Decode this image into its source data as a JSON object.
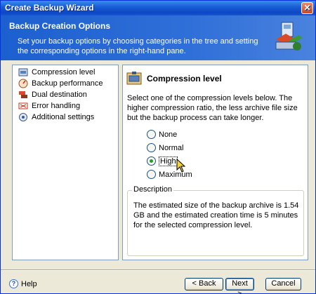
{
  "window": {
    "title": "Create Backup Wizard",
    "close_glyph": "✕"
  },
  "header": {
    "title": "Backup Creation Options",
    "description": "Set your backup options by choosing categories in the tree and setting the corresponding options in the right-hand pane.",
    "icon": "backup-wizard-icon"
  },
  "tree": {
    "items": [
      {
        "label": "Compression level",
        "icon": "compression-icon"
      },
      {
        "label": "Backup performance",
        "icon": "performance-icon"
      },
      {
        "label": "Dual destination",
        "icon": "dual-destination-icon"
      },
      {
        "label": "Error handling",
        "icon": "error-handling-icon"
      },
      {
        "label": "Additional settings",
        "icon": "additional-settings-icon"
      }
    ]
  },
  "pane": {
    "title": "Compression level",
    "description": "Select one of the compression levels below. The higher compression ratio, the less archive file size but the backup process can take longer.",
    "options": [
      {
        "label": "None",
        "checked": false
      },
      {
        "label": "Normal",
        "checked": false
      },
      {
        "label": "High",
        "checked": true
      },
      {
        "label": "Maximum",
        "checked": false
      }
    ],
    "description_group": {
      "title": "Description",
      "text": "The estimated size of the backup archive is 1.54 GB and the estimated creation time is 5 minutes for the selected compression level."
    }
  },
  "footer": {
    "help_label": "Help",
    "back_label": "< Back",
    "next_label": "Next >",
    "cancel_label": "Cancel"
  },
  "colors": {
    "title_bar": "#0d47c4",
    "header_bg": "#1c5fcf",
    "radio_check": "#21a121",
    "window_bg": "#ece9d8"
  }
}
